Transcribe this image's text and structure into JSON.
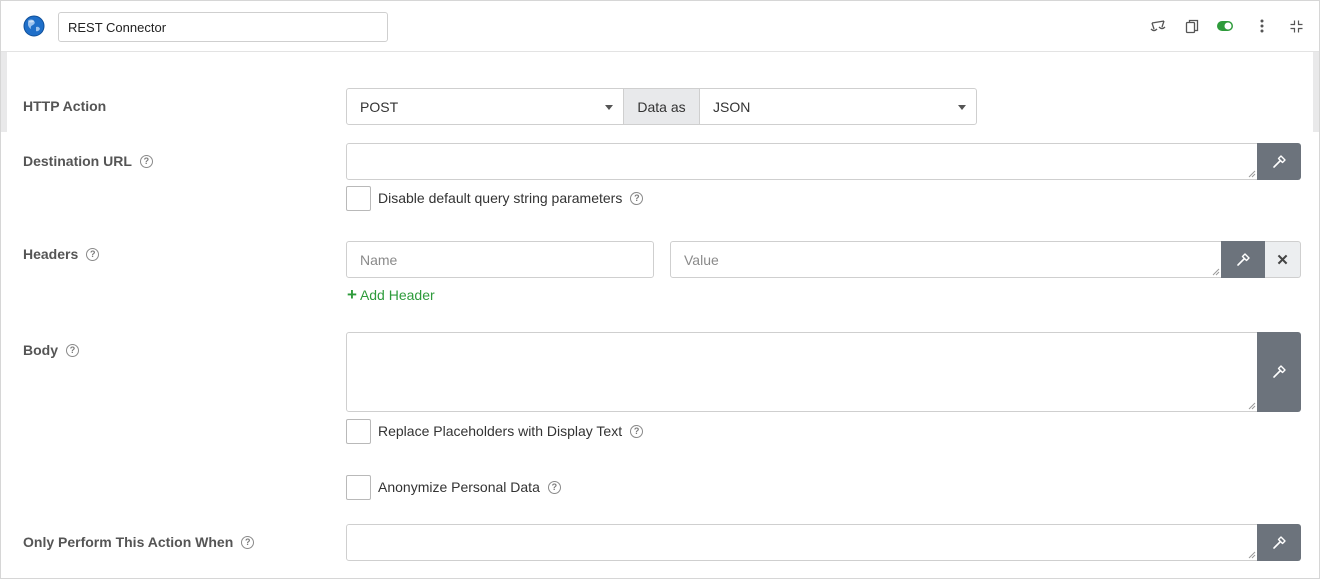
{
  "header": {
    "connector_name": "REST Connector",
    "icons": [
      "globe-icon",
      "scale-icon",
      "copy-icon",
      "toggle-icon",
      "more-vertical-icon",
      "collapse-icon"
    ],
    "toggle_on_color": "#2e9b3b"
  },
  "http_action": {
    "label": "HTTP Action",
    "method": "POST",
    "data_as_label": "Data as",
    "data_format": "JSON"
  },
  "destination_url": {
    "label": "Destination URL",
    "value": "",
    "disable_qs_label": "Disable default query string parameters"
  },
  "headers": {
    "label": "Headers",
    "name_placeholder": "Name",
    "value_placeholder": "Value",
    "remove_label": "✕",
    "add_label": "Add Header",
    "add_icon": "+"
  },
  "body": {
    "label": "Body",
    "value": "",
    "replace_placeholders_label": "Replace Placeholders with Display Text",
    "anonymize_label": "Anonymize Personal Data"
  },
  "condition": {
    "label": "Only Perform This Action When",
    "value": ""
  },
  "help_glyph": "?",
  "colors": {
    "accent_green": "#2e9b3b",
    "wrench_button": "#6c737c"
  }
}
